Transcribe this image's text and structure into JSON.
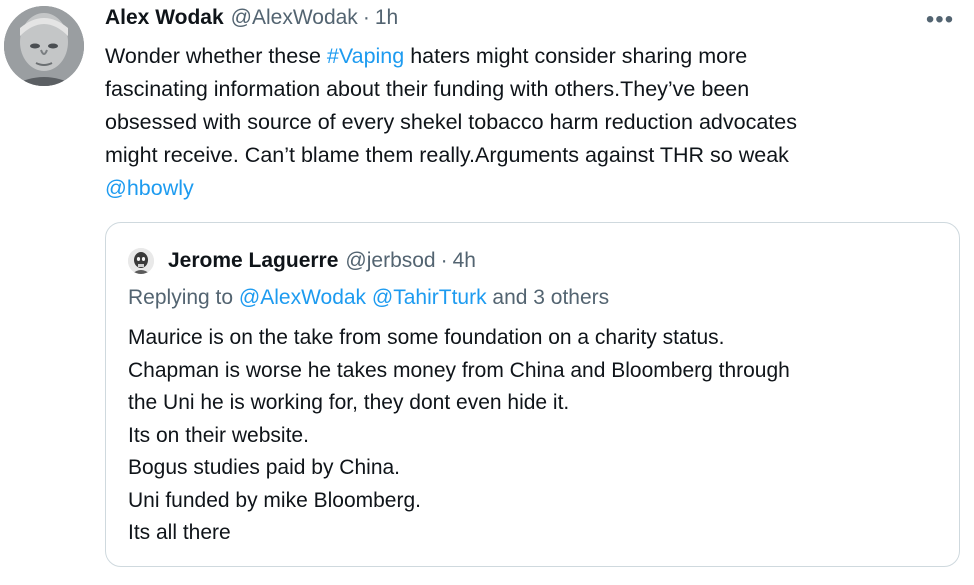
{
  "tweet": {
    "author_name": "Alex Wodak",
    "author_handle": "@AlexWodak",
    "separator": "·",
    "time": "1h",
    "more_icon": "•••",
    "text": {
      "line1_pre": "Wonder whether these ",
      "hashtag": "#Vaping",
      "line1_post": " haters might consider sharing more",
      "line2": "fascinating information about their funding with others.They’ve been",
      "line3": "obsessed with source of every shekel tobacco harm reduction advocates",
      "line4": "might receive. Can’t blame them really.Arguments against THR so weak",
      "mention": "@hbowly"
    }
  },
  "quoted": {
    "author_name": "Jerome Laguerre",
    "author_handle": "@jerbsod",
    "separator": "·",
    "time": "4h",
    "replying": {
      "prefix": "Replying to ",
      "mention1": "@AlexWodak",
      "mention2": "@TahirTturk",
      "suffix": " and 3 others"
    },
    "lines": [
      "Maurice is on the take  from some foundation on a charity status.",
      "Chapman is worse he takes money from China and Bloomberg through",
      "the Uni he is working for, they dont even hide it.",
      "Its on their website.",
      "Bogus studies paid by China.",
      "Uni funded by mike Bloomberg.",
      "Its all there"
    ]
  }
}
